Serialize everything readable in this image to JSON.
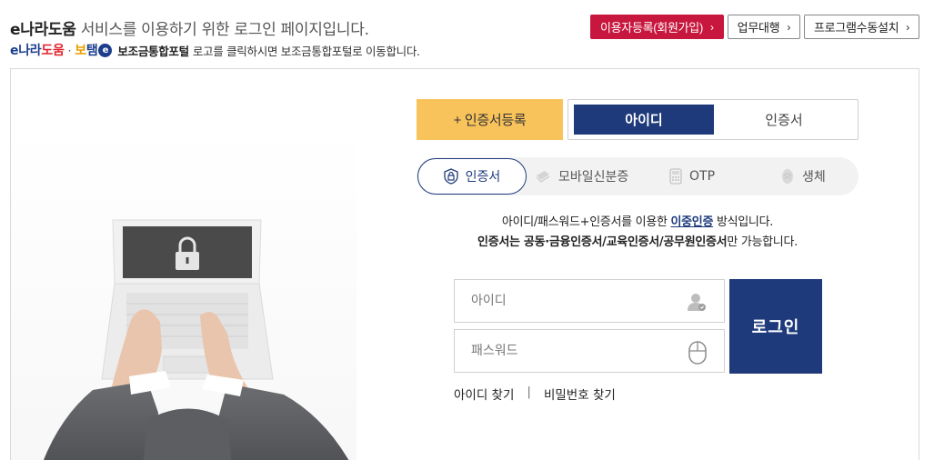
{
  "header": {
    "title_brand": "e나라도움",
    "title_rest": " 서비스를 이용하기 위한 로그인 페이지입니다.",
    "sub_logo1_e": "e",
    "sub_logo1_nara": "나라",
    "sub_logo1_dowoom": "도움",
    "sub_dot": "·",
    "sub_logo2_bo": "보",
    "sub_logo2_rest": "탬",
    "sub_logo2_badge": "e",
    "sub_portal": "보조금통합포털",
    "sub_text": "로고를 클릭하시면 보조금통합포털로 이동합니다."
  },
  "top_buttons": {
    "register": "이용자등록(회원가입)",
    "proxy": "업무대행",
    "install": "프로그램수동설치",
    "chevron": "›"
  },
  "tabs": {
    "cert_register": "+ 인증서등록",
    "id": "아이디",
    "cert": "인증서"
  },
  "methods": {
    "cert": "인증서",
    "mobile": "모바일신분증",
    "otp": "OTP",
    "bio": "생체"
  },
  "description": {
    "line1_pre": "아이디/패스워드+인증서를 이용한 ",
    "line1_link": "이중인증",
    "line1_post": " 방식입니다.",
    "line2_bold": "인증서는 공동·금융인증서/교육인증서/공무원인증서",
    "line2_post": "만 가능합니다."
  },
  "form": {
    "id_placeholder": "아이디",
    "pw_placeholder": "패스워드",
    "login": "로그인"
  },
  "links": {
    "find_id": "아이디 찾기",
    "separator": "|",
    "find_pw": "비밀번호 찾기"
  },
  "colors": {
    "navy": "#1e3a7b",
    "yellow": "#f9c35c",
    "red": "#c8173e"
  }
}
